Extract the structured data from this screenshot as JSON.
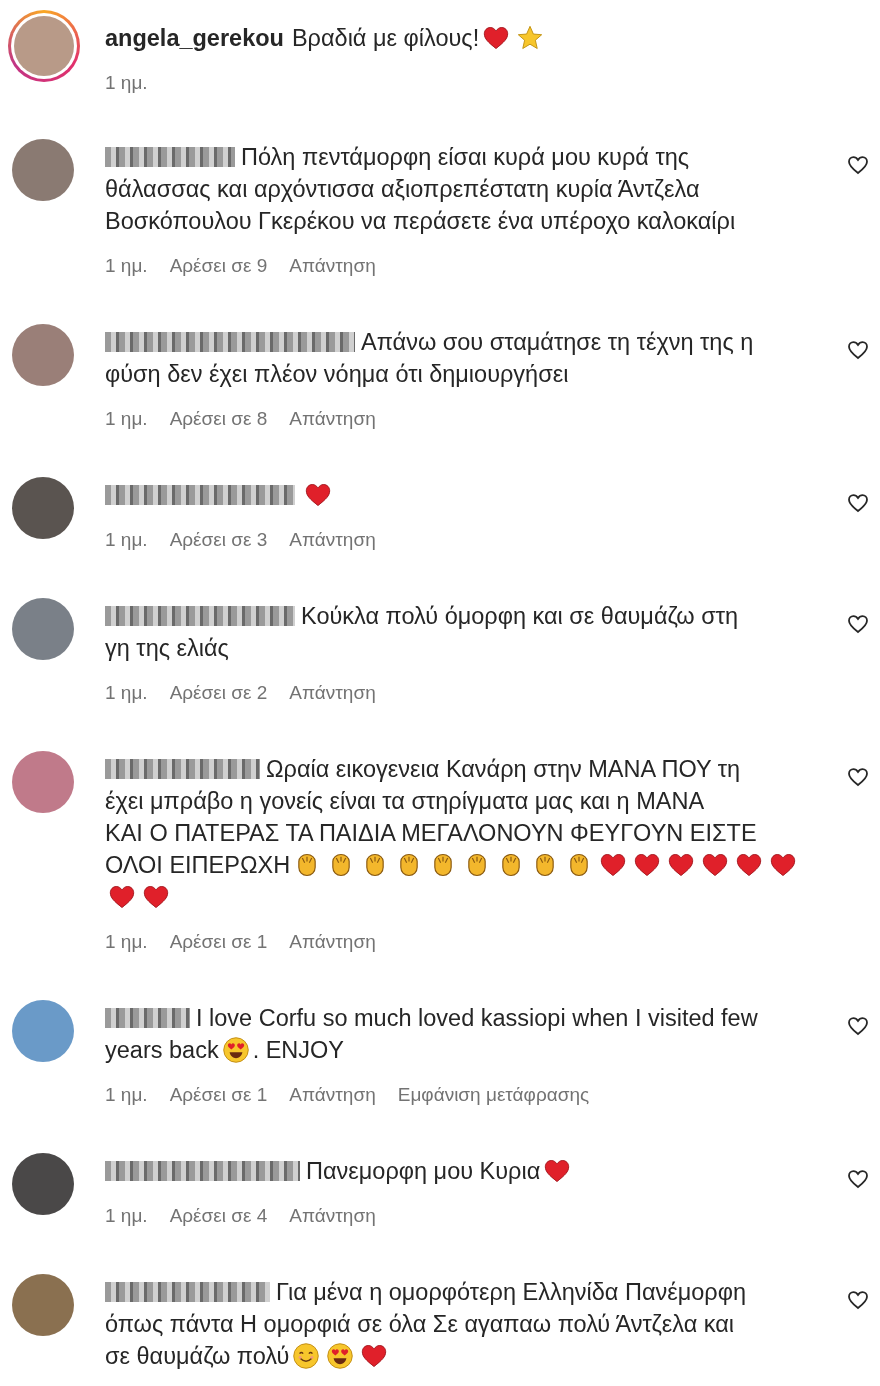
{
  "caption": {
    "username": "angela_gerekou",
    "lines": [
      [
        {
          "kind": "text",
          "text": "Βραδιά με φίλους!"
        },
        {
          "kind": "heart"
        },
        {
          "kind": "star"
        }
      ]
    ],
    "time": "1 ημ."
  },
  "comments": [
    {
      "lines": [
        [
          {
            "kind": "text",
            "text": "Πόλη πεντάμορφη είσαι κυρά μου κυρά της"
          }
        ],
        [
          {
            "kind": "text",
            "text": "θάλασσας και αρχόντισσα αξιοπρεπέστατη κυρία Άντζελα"
          }
        ],
        [
          {
            "kind": "text",
            "text": "Βοσκόπουλου Γκερέκου να περάσετε ένα υπέροχο καλοκαίρι"
          }
        ]
      ],
      "time": "1 ημ.",
      "likes": "Αρέσει σε 9",
      "reply": "Απάντηση"
    },
    {
      "lines": [
        [
          {
            "kind": "text",
            "text": "Απάνω σου σταμάτησε τη τέχνη της η"
          }
        ],
        [
          {
            "kind": "text",
            "text": "φύση δεν έχει πλέον νόημα ότι δημιουργήσει"
          }
        ]
      ],
      "time": "1 ημ.",
      "likes": "Αρέσει σε 8",
      "reply": "Απάντηση"
    },
    {
      "lines": [
        [
          {
            "kind": "heart"
          }
        ]
      ],
      "time": "1 ημ.",
      "likes": "Αρέσει σε 3",
      "reply": "Απάντηση"
    },
    {
      "lines": [
        [
          {
            "kind": "text",
            "text": "Κούκλα πολύ όμορφη και σε θαυμάζω στη"
          }
        ],
        [
          {
            "kind": "text",
            "text": "γη της ελιάς"
          }
        ]
      ],
      "time": "1 ημ.",
      "likes": "Αρέσει σε 2",
      "reply": "Απάντηση"
    },
    {
      "lines": [
        [
          {
            "kind": "text",
            "text": "Ωραία εικογενεια Κανάρη στην ΜΑΝΑ ΠΟΥ τη"
          }
        ],
        [
          {
            "kind": "text",
            "text": "έχει μπράβο η γονείς είναι τα στηρίγματα μας και η ΜΑΝΑ"
          }
        ],
        [
          {
            "kind": "text",
            "text": "ΚΑΙ Ο ΠΑΤΕΡΑΣ ΤΑ ΠΑΙΔΙΑ ΜΕΓΑΛΟΝΟΥΝ ΦΕΥΓΟΥΝ ΕΙΣΤΕ"
          }
        ],
        [
          {
            "kind": "text",
            "text": "ΟΛΟΙ ΕΙΠΕΡΩΧΗ"
          },
          {
            "kind": "clap"
          },
          {
            "kind": "clap"
          },
          {
            "kind": "clap"
          },
          {
            "kind": "clap"
          },
          {
            "kind": "clap"
          },
          {
            "kind": "clap"
          },
          {
            "kind": "clap"
          },
          {
            "kind": "clap"
          },
          {
            "kind": "clap"
          },
          {
            "kind": "heart"
          },
          {
            "kind": "heart"
          },
          {
            "kind": "heart"
          },
          {
            "kind": "heart"
          },
          {
            "kind": "heart"
          },
          {
            "kind": "heart"
          }
        ],
        [
          {
            "kind": "heart"
          },
          {
            "kind": "heart"
          }
        ]
      ],
      "time": "1 ημ.",
      "likes": "Αρέσει σε 1",
      "reply": "Απάντηση"
    },
    {
      "lines": [
        [
          {
            "kind": "text",
            "text": "I love Corfu so much loved kassiopi when I visited few"
          }
        ],
        [
          {
            "kind": "text",
            "text": "years back"
          },
          {
            "kind": "heart-eyes"
          },
          {
            "kind": "text",
            "text": ". ENJOY"
          }
        ]
      ],
      "time": "1 ημ.",
      "likes": "Αρέσει σε 1",
      "reply": "Απάντηση",
      "translate": "Εμφάνιση μετάφρασης"
    },
    {
      "lines": [
        [
          {
            "kind": "text",
            "text": "Πανεμορφη μου Κυρια"
          },
          {
            "kind": "heart"
          }
        ]
      ],
      "time": "1 ημ.",
      "likes": "Αρέσει σε 4",
      "reply": "Απάντηση"
    },
    {
      "lines": [
        [
          {
            "kind": "text",
            "text": "Για μένα η ομορφότερη Ελληνίδα Πανέμορφη"
          }
        ],
        [
          {
            "kind": "text",
            "text": "όπως πάντα Η ομορφιά σε όλα Σε αγαπαω πολύ Άντζελα και"
          }
        ],
        [
          {
            "kind": "text",
            "text": "σε θαυμάζω πολύ"
          },
          {
            "kind": "smile"
          },
          {
            "kind": "heart-eyes"
          },
          {
            "kind": "heart"
          }
        ]
      ]
    }
  ]
}
